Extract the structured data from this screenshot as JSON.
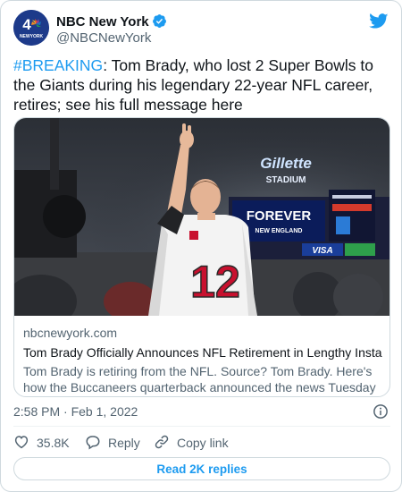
{
  "author": {
    "name": "NBC New York",
    "handle": "@NBCNewYork",
    "avatar_text": "NEWYORK",
    "verified": true
  },
  "tweet": {
    "hashtag": "#BREAKING",
    "text": ": Tom Brady, who lost 2 Super Bowls to the Giants during his legendary 22-year NFL career, retires; see his full message here"
  },
  "link_card": {
    "domain": "nbcnewyork.com",
    "title": "Tom Brady Officially Announces NFL Retirement in Lengthy Instagra…",
    "description": "Tom Brady is retiring from the NFL. Source? Tom Brady. Here's how the Buccaneers quarterback announced the news Tuesday morning.",
    "image": {
      "stadium_sign": "Gillette",
      "stadium_sub": "STADIUM",
      "jersey_number": "12",
      "board_text": "FOREVER",
      "board_sub": "NEW ENGLAND",
      "ad_text": "VISA"
    }
  },
  "meta": {
    "timestamp": "2:58 PM · Feb 1, 2022"
  },
  "actions": {
    "like_count": "35.8K",
    "reply_label": "Reply",
    "copy_label": "Copy link"
  },
  "read_replies_label": "Read 2K replies",
  "colors": {
    "accent": "#1d9bf0",
    "text": "#0f1419",
    "muted": "#536471",
    "border": "#cfd9de"
  },
  "icons": [
    "verified-badge-icon",
    "twitter-bird-icon",
    "info-icon",
    "heart-icon",
    "reply-icon",
    "link-icon"
  ]
}
